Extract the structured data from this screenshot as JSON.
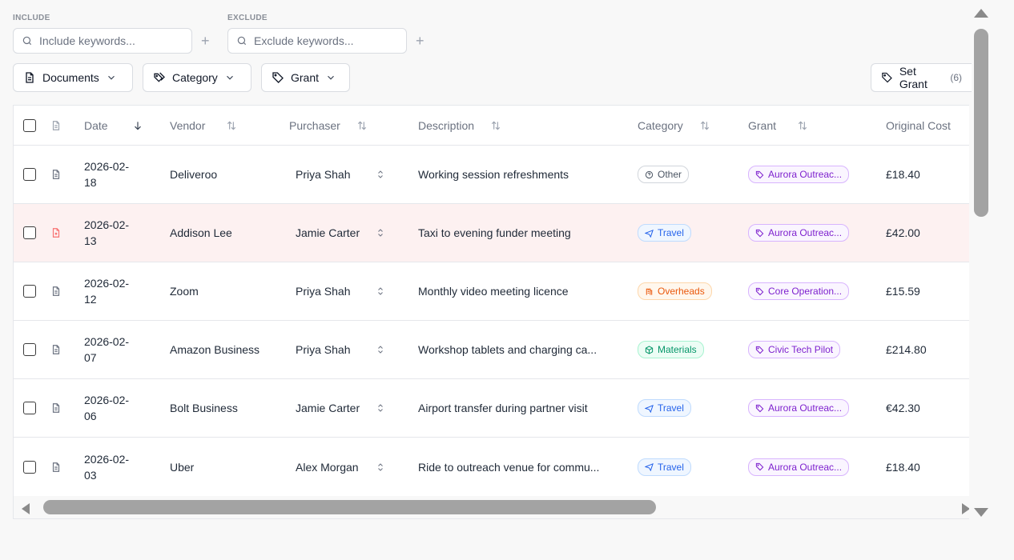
{
  "filters": {
    "include_label": "INCLUDE",
    "include_placeholder": "Include keywords...",
    "exclude_label": "EXCLUDE",
    "exclude_placeholder": "Exclude keywords..."
  },
  "toolbar": {
    "documents": "Documents",
    "category": "Category",
    "grant": "Grant",
    "set_grant": "Set Grant",
    "set_grant_count": "(6)"
  },
  "table": {
    "headers": {
      "date": "Date",
      "vendor": "Vendor",
      "purchaser": "Purchaser",
      "description": "Description",
      "category": "Category",
      "grant": "Grant",
      "original_cost": "Original Cost"
    },
    "rows": [
      {
        "date_a": "2026-02-",
        "date_b": "18",
        "vendor": "Deliveroo",
        "purchaser": "Priya Shah",
        "description": "Working session refreshments",
        "category": "Other",
        "grant": "Aurora Outreac...",
        "cost": "£18.40"
      },
      {
        "date_a": "2026-02-",
        "date_b": "13",
        "vendor": "Addison Lee",
        "purchaser": "Jamie Carter",
        "description": "Taxi to evening funder meeting",
        "category": "Travel",
        "grant": "Aurora Outreac...",
        "cost": "£42.00"
      },
      {
        "date_a": "2026-02-",
        "date_b": "12",
        "vendor": "Zoom",
        "purchaser": "Priya Shah",
        "description": "Monthly video meeting licence",
        "category": "Overheads",
        "grant": "Core Operation...",
        "cost": "£15.59"
      },
      {
        "date_a": "2026-02-",
        "date_b": "07",
        "vendor": "Amazon Business",
        "purchaser": "Priya Shah",
        "description": "Workshop tablets and charging ca...",
        "category": "Materials",
        "grant": "Civic Tech Pilot",
        "cost": "£214.80"
      },
      {
        "date_a": "2026-02-",
        "date_b": "06",
        "vendor": "Bolt Business",
        "purchaser": "Jamie Carter",
        "description": "Airport transfer during partner visit",
        "category": "Travel",
        "grant": "Aurora Outreac...",
        "cost": "€42.30"
      },
      {
        "date_a": "2026-02-",
        "date_b": "03",
        "vendor": "Uber",
        "purchaser": "Alex Morgan",
        "description": "Ride to outreach venue for commu...",
        "category": "Travel",
        "grant": "Aurora Outreac...",
        "cost": "£18.40"
      }
    ]
  }
}
